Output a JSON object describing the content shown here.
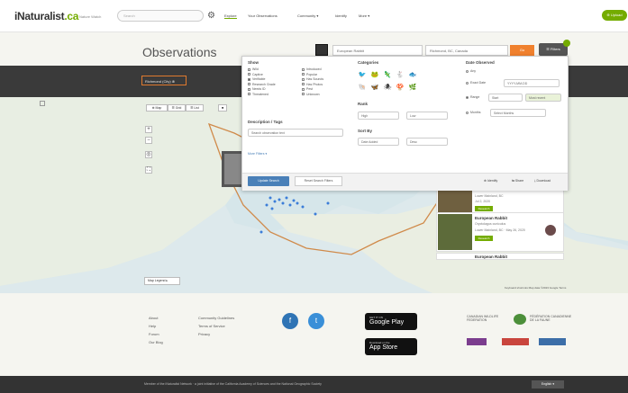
{
  "topbar": {
    "logo_main": "iNaturalist",
    "logo_suffix": ".ca",
    "logo_sub": "Nature Watch",
    "search_placeholder": "Search",
    "nav": [
      "Explore",
      "Your Observations",
      "Community ▾",
      "Identify",
      "More ▾"
    ],
    "upload": "⊕ Upload"
  },
  "header": {
    "title": "Observations",
    "species_placeholder": "European Rabbit",
    "location": "Richmond, BC, Canada",
    "go": "Go",
    "filters": "☰ Filters"
  },
  "darkbar": {
    "place_chip": "Richmond (City) ⊗"
  },
  "map_tabs": [
    "⊕ Map",
    "☰ Grid",
    "☰ List",
    "■",
    "▪"
  ],
  "filter_panel": {
    "show_title": "Show",
    "show_col1": [
      "Wild",
      "Captive",
      "Verifiable",
      "Research Grade",
      "Needs ID",
      "Threatened"
    ],
    "show_col2": [
      "Introduced",
      "Popular",
      "Has Sounds",
      "Has Photos",
      "Pest",
      "Unknown"
    ],
    "desc_title": "Description / Tags",
    "desc_placeholder": "Search observation text",
    "more_filters": "More Filters ▾",
    "categories_title": "Categories",
    "category_icons": [
      "bird-icon",
      "amphibian-icon",
      "reptile-icon",
      "mammal-icon",
      "fish-icon",
      "mollusk-icon",
      "insect-icon",
      "arachnid-icon",
      "fungi-icon",
      "plant-icon"
    ],
    "category_glyphs": [
      "🐦",
      "🐸",
      "🦎",
      "🐇",
      "🐟",
      "🐚",
      "🦋",
      "🕷",
      "🍄",
      "🌿"
    ],
    "rank_title": "Rank",
    "rank_high": "High",
    "rank_low": "Low",
    "sort_title": "Sort By",
    "sort_value": "Date Added",
    "sort_order": "Desc",
    "date_title": "Date Observed",
    "date_any": "Any",
    "date_exact": "Exact Date",
    "date_exact_ph": "YYYY-MM-DD",
    "date_range": "Range",
    "date_start_ph": "Start",
    "date_end_ph": "Most recent",
    "date_months": "Months",
    "months_select": "Select Months",
    "update_btn": "Update Search",
    "reset_btn": "Reset Search Filters",
    "identify": "⊕ Identify",
    "share": "⇆ Share",
    "download": "⤓ Download"
  },
  "map": {
    "legend": "Map Legend ▸",
    "attribution": "Keyboard shortcuts  Map data ©2023 Google  Terms"
  },
  "cards": [
    {
      "title": "",
      "sub1": "Lower Mainland, BC",
      "sub2": "Jul 2, 2020",
      "badge": "Research Grade"
    },
    {
      "title": "European Rabbit",
      "sub1": "Oryctolagus cuniculus",
      "sub2": "Lower Mainland, BC · May 26, 2020",
      "badge": "Research Grade"
    },
    {
      "title": "European Rabbit",
      "sub1": "",
      "sub2": "",
      "badge": ""
    }
  ],
  "footer": {
    "col1": [
      "About",
      "Help",
      "Forum",
      "Our Blog"
    ],
    "col2": [
      "Community Guidelines",
      "Terms of Service",
      "Privacy"
    ],
    "google_play_small": "GET IT ON",
    "google_play": "Google Play",
    "app_store_small": "Download on the",
    "app_store": "App Store",
    "cwf": "CANADIAN WILDLIFE FEDERATION",
    "fcf": "FÉDÉRATION CANADIENNE DE LA FAUNE",
    "partners": [
      "Partner",
      "Partner",
      "Partner"
    ]
  },
  "bottombar": {
    "text": "Member of the iNaturalist Network · a joint initiative of the California Academy of Sciences and the National Geographic Society",
    "language": "English ▾"
  },
  "colors": {
    "brand": "#74ac00",
    "go": "#f0812e",
    "update": "#4a80b8"
  }
}
